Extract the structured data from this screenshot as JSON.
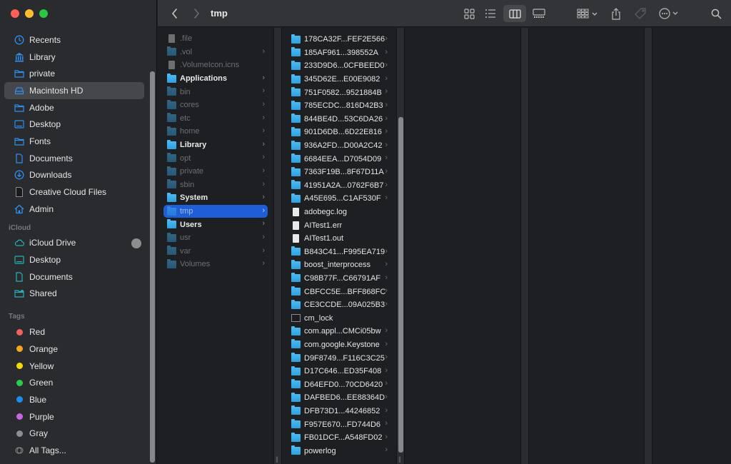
{
  "window": {
    "title": "tmp"
  },
  "toolbar": {
    "back": "back",
    "forward": "forward",
    "view_icons": "icon-view",
    "view_list": "list-view",
    "view_columns": "column-view",
    "view_gallery": "gallery-view",
    "group": "group-by",
    "share": "share",
    "tags": "tags",
    "more": "more-actions",
    "search": "search"
  },
  "sidebar": {
    "favorites": [
      {
        "label": "Recents",
        "icon": "clock"
      },
      {
        "label": "Library",
        "icon": "building-columns"
      },
      {
        "label": "private",
        "icon": "folder"
      },
      {
        "label": "Macintosh HD",
        "icon": "drive",
        "selected": true
      },
      {
        "label": "Adobe",
        "icon": "folder"
      },
      {
        "label": "Desktop",
        "icon": "desktop"
      },
      {
        "label": "Fonts",
        "icon": "folder"
      },
      {
        "label": "Documents",
        "icon": "document"
      },
      {
        "label": "Downloads",
        "icon": "download"
      },
      {
        "label": "Creative Cloud Files",
        "icon": "file"
      },
      {
        "label": "Admin",
        "icon": "house"
      }
    ],
    "icloud_header": "iCloud",
    "icloud": [
      {
        "label": "iCloud Drive",
        "icon": "cloud"
      },
      {
        "label": "Desktop",
        "icon": "desktop"
      },
      {
        "label": "Documents",
        "icon": "document"
      },
      {
        "label": "Shared",
        "icon": "shared-folder"
      }
    ],
    "tags_header": "Tags",
    "tags": [
      {
        "label": "Red",
        "color": "#f0625c"
      },
      {
        "label": "Orange",
        "color": "#f5a623"
      },
      {
        "label": "Yellow",
        "color": "#f5d90a"
      },
      {
        "label": "Green",
        "color": "#2ccc49"
      },
      {
        "label": "Blue",
        "color": "#1d8cf0"
      },
      {
        "label": "Purple",
        "color": "#c467e0"
      },
      {
        "label": "Gray",
        "color": "#8e8e91"
      },
      {
        "label": "All Tags...",
        "color": "outline"
      }
    ]
  },
  "column1": [
    {
      "name": ".file",
      "type": "doc",
      "dim": true,
      "chevron": false
    },
    {
      "name": ".vol",
      "type": "folder",
      "dim": true,
      "chevron": true
    },
    {
      "name": ".VolumeIcon.icns",
      "type": "doc",
      "dim": true,
      "chevron": false
    },
    {
      "name": "Applications",
      "type": "folder",
      "bold": true,
      "chevron": true
    },
    {
      "name": "bin",
      "type": "folder",
      "dim": true,
      "chevron": true
    },
    {
      "name": "cores",
      "type": "folder",
      "dim": true,
      "chevron": true
    },
    {
      "name": "etc",
      "type": "folder",
      "dim": true,
      "chevron": true
    },
    {
      "name": "home",
      "type": "folder",
      "dim": true,
      "chevron": true
    },
    {
      "name": "Library",
      "type": "folder",
      "bold": true,
      "chevron": true
    },
    {
      "name": "opt",
      "type": "folder",
      "dim": true,
      "chevron": true
    },
    {
      "name": "private",
      "type": "folder",
      "dim": true,
      "chevron": true
    },
    {
      "name": "sbin",
      "type": "folder",
      "dim": true,
      "chevron": true
    },
    {
      "name": "System",
      "type": "folder",
      "bold": true,
      "chevron": true
    },
    {
      "name": "tmp",
      "type": "folder",
      "selected": true,
      "chevron": true
    },
    {
      "name": "Users",
      "type": "folder",
      "bold": true,
      "chevron": true
    },
    {
      "name": "usr",
      "type": "folder",
      "dim": true,
      "chevron": true
    },
    {
      "name": "var",
      "type": "folder",
      "dim": true,
      "chevron": true
    },
    {
      "name": "Volumes",
      "type": "folder",
      "dim": true,
      "chevron": true
    }
  ],
  "column2": [
    {
      "name": "178CA32F...FEF2E566",
      "type": "folder",
      "chevron": true
    },
    {
      "name": "185AF961...398552A",
      "type": "folder",
      "chevron": true
    },
    {
      "name": "233D9D6...0CFBEED0",
      "type": "folder",
      "chevron": true
    },
    {
      "name": "345D62E...E00E9082",
      "type": "folder",
      "chevron": true
    },
    {
      "name": "751F0582...9521884B",
      "type": "folder",
      "chevron": true
    },
    {
      "name": "785ECDC...816D42B3",
      "type": "folder",
      "chevron": true
    },
    {
      "name": "844BE4D...53C6DA26",
      "type": "folder",
      "chevron": true
    },
    {
      "name": "901D6DB...6D22E816",
      "type": "folder",
      "chevron": true
    },
    {
      "name": "936A2FD...D00A2C42",
      "type": "folder",
      "chevron": true
    },
    {
      "name": "6684EEA...D7054D09",
      "type": "folder",
      "chevron": true
    },
    {
      "name": "7363F19B...8F67D11A",
      "type": "folder",
      "chevron": true
    },
    {
      "name": "41951A2A...0762F6B7",
      "type": "folder",
      "chevron": true
    },
    {
      "name": "A45E695...C1AF530F",
      "type": "folder",
      "chevron": true
    },
    {
      "name": "adobegc.log",
      "type": "doc",
      "chevron": false
    },
    {
      "name": "AITest1.err",
      "type": "doc",
      "chevron": false
    },
    {
      "name": "AITest1.out",
      "type": "doc",
      "chevron": false
    },
    {
      "name": "B843C41...F995EA719",
      "type": "folder",
      "chevron": true
    },
    {
      "name": "boost_interprocess",
      "type": "folder",
      "chevron": true
    },
    {
      "name": "C98B77F...C66791AF",
      "type": "folder",
      "chevron": true
    },
    {
      "name": "CBFCC5E...BFF868FC",
      "type": "folder",
      "chevron": true
    },
    {
      "name": "CE3CCDE...09A025B3",
      "type": "folder",
      "chevron": true
    },
    {
      "name": "cm_lock",
      "type": "exec",
      "chevron": false
    },
    {
      "name": "com.appl...CMCi05bw",
      "type": "folder",
      "chevron": true
    },
    {
      "name": "com.google.Keystone",
      "type": "folder",
      "chevron": true
    },
    {
      "name": "D9F8749...F116C3C25",
      "type": "folder",
      "chevron": true
    },
    {
      "name": "D17C646...ED35F408",
      "type": "folder",
      "chevron": true
    },
    {
      "name": "D64EFD0...70CD6420",
      "type": "folder",
      "chevron": true
    },
    {
      "name": "DAFBED6...EE88364D",
      "type": "folder",
      "chevron": true
    },
    {
      "name": "DFB73D1...44246852",
      "type": "folder",
      "chevron": true
    },
    {
      "name": "F957E670...FD744D6",
      "type": "folder",
      "chevron": true
    },
    {
      "name": "FB01DCF...A548FD02",
      "type": "folder",
      "chevron": true
    },
    {
      "name": "powerlog",
      "type": "folder",
      "chevron": true
    }
  ]
}
